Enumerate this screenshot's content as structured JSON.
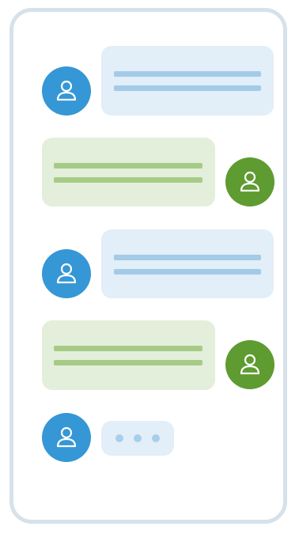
{
  "theme": {
    "incoming_avatar_color": "#3597d5",
    "outgoing_avatar_color": "#5e9b31",
    "incoming_bubble_color": "#e2eef8",
    "outgoing_bubble_color": "#e3efda",
    "incoming_line_color": "#a3cbe8",
    "outgoing_line_color": "#a6cb86",
    "frame_border_color": "#d7e1ea",
    "typing_dot_color": "#a8cfe9"
  },
  "messages": [
    {
      "sender": "incoming",
      "avatar_icon": "user-icon"
    },
    {
      "sender": "outgoing",
      "avatar_icon": "user-icon"
    },
    {
      "sender": "incoming",
      "avatar_icon": "user-icon"
    },
    {
      "sender": "outgoing",
      "avatar_icon": "user-icon"
    }
  ],
  "typing_indicator": {
    "sender": "incoming",
    "avatar_icon": "user-icon",
    "dots": 3
  }
}
